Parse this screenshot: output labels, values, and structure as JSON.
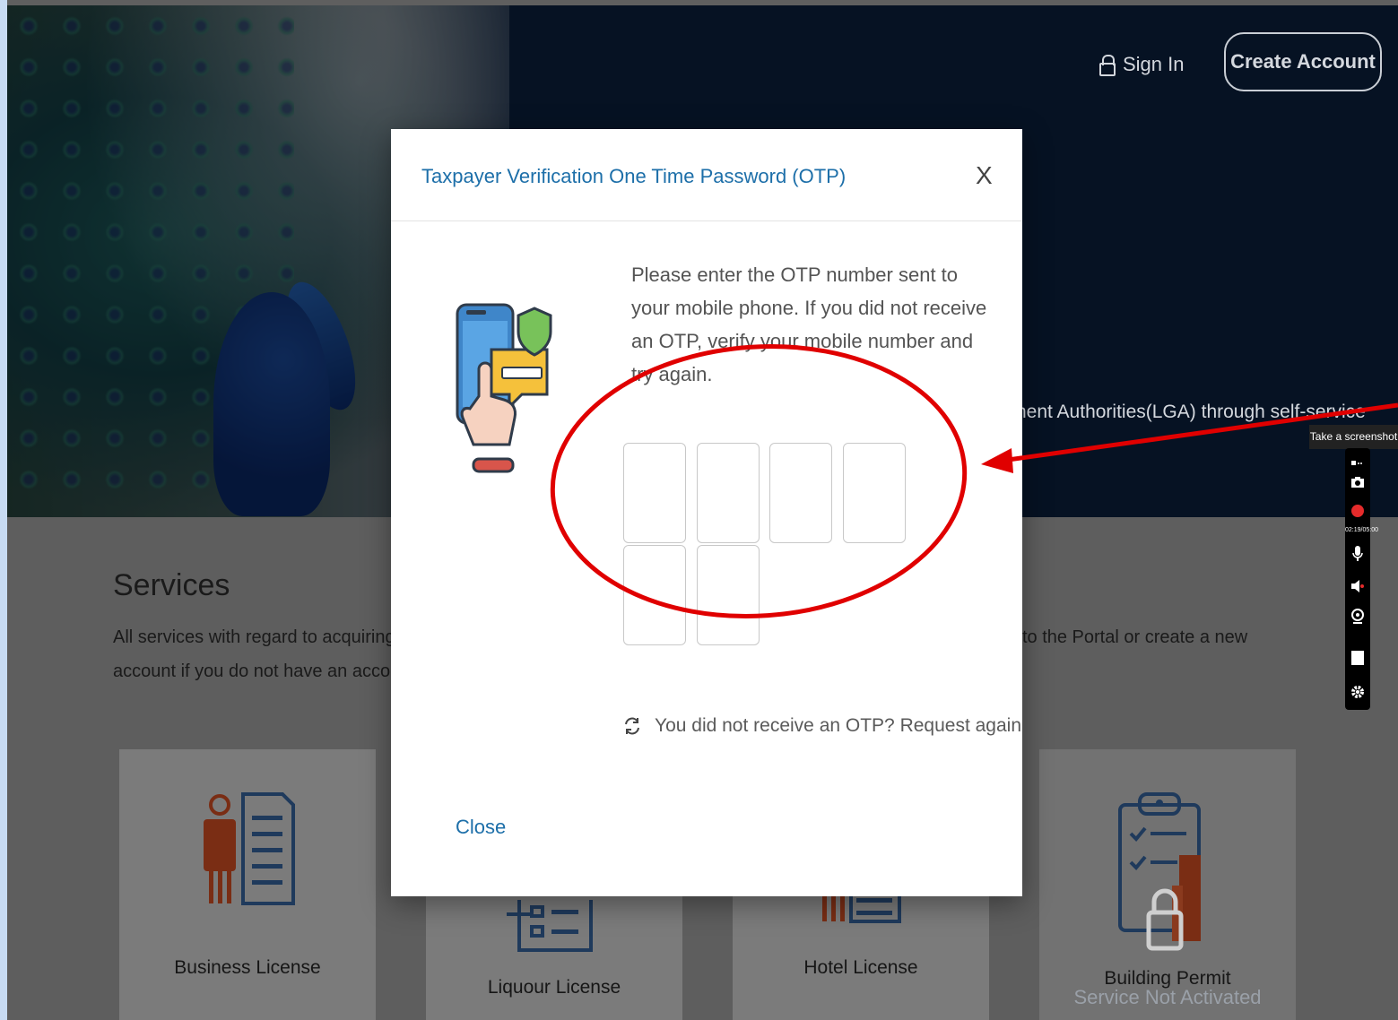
{
  "header": {
    "sign_in_label": "Sign In",
    "create_account_label": "Create Account",
    "hero_tagline": "nent Authorities(LGA) through self-service"
  },
  "services": {
    "title": "Services",
    "description": "All services with regard to acquiring li                                                                                                  og in to the Portal or create a new account if you do not have an accoun",
    "desc_line1_left": "All services with regard to acquiring li",
    "desc_line1_right": "og in to the Portal or create a new",
    "desc_line2": "account if you do not have an accoun",
    "cards": [
      {
        "label": "Business License"
      },
      {
        "label": "Liquour License"
      },
      {
        "label": "Hotel License"
      },
      {
        "label": "Building Permit",
        "status": "Service Not Activated"
      }
    ]
  },
  "modal": {
    "title": "Taxpayer Verification One Time Password (OTP)",
    "close_x": "X",
    "instructions": "Please enter the OTP number sent to your mobile phone. If you did not receive an OTP, verify your mobile number and try again.",
    "otp_digits": [
      "",
      "",
      "",
      "",
      "",
      ""
    ],
    "resend_text": "You did not receive an OTP? Request again",
    "close_label": "Close"
  },
  "recorder": {
    "tooltip": "Take a screenshot",
    "timer": "02:19/05:00"
  },
  "colors": {
    "modal_accent": "#1d6fa9",
    "annotation_red": "#e00000",
    "hero_navy": "#0b2140"
  }
}
